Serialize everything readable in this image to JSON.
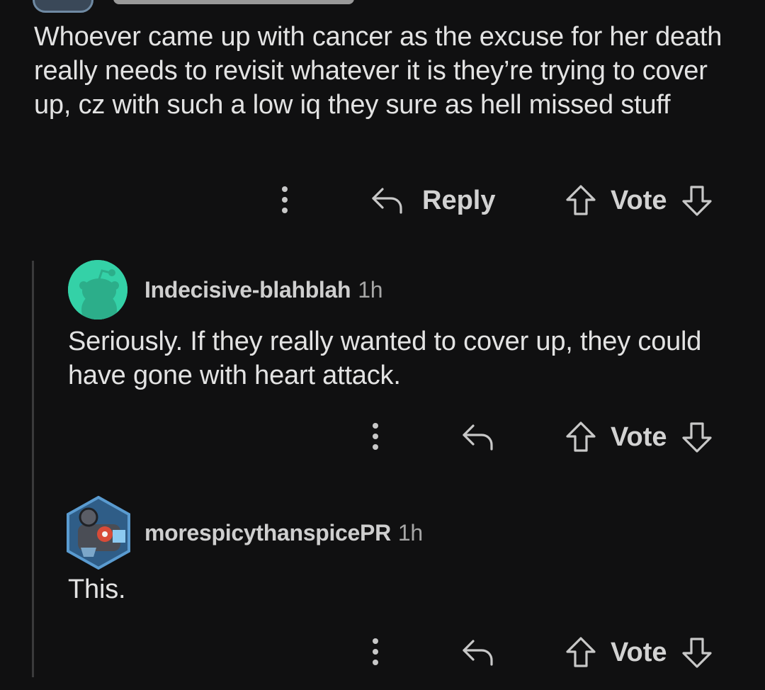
{
  "top_comment": {
    "text": "Whoever came up with cancer as the excuse for her death really needs to revisit whatever it is they’re trying to cover up, cz with such a low iq they sure as hell missed stuff",
    "actions": {
      "reply_label": "Reply",
      "vote_label": "Vote"
    }
  },
  "replies": [
    {
      "username": "Indecisive-blahblah",
      "timestamp": "1h",
      "avatar_color": "#34d1a7",
      "text": "Seriously. If they really wanted to cover up, they could have gone with heart attack.",
      "vote_label": "Vote"
    },
    {
      "username": "morespicythanspicePR",
      "timestamp": "1h",
      "avatar_color": "#4f84b6",
      "text": "This.",
      "vote_label": "Vote"
    }
  ],
  "colors": {
    "background": "#101011",
    "text": "#e3e3e3",
    "secondary_text": "#a6a6a6",
    "thread_line": "#3a3a3b"
  },
  "icons": {
    "more": "more-vertical-icon",
    "reply": "reply-arrow-icon",
    "upvote": "upvote-arrow-icon",
    "downvote": "downvote-arrow-icon"
  }
}
